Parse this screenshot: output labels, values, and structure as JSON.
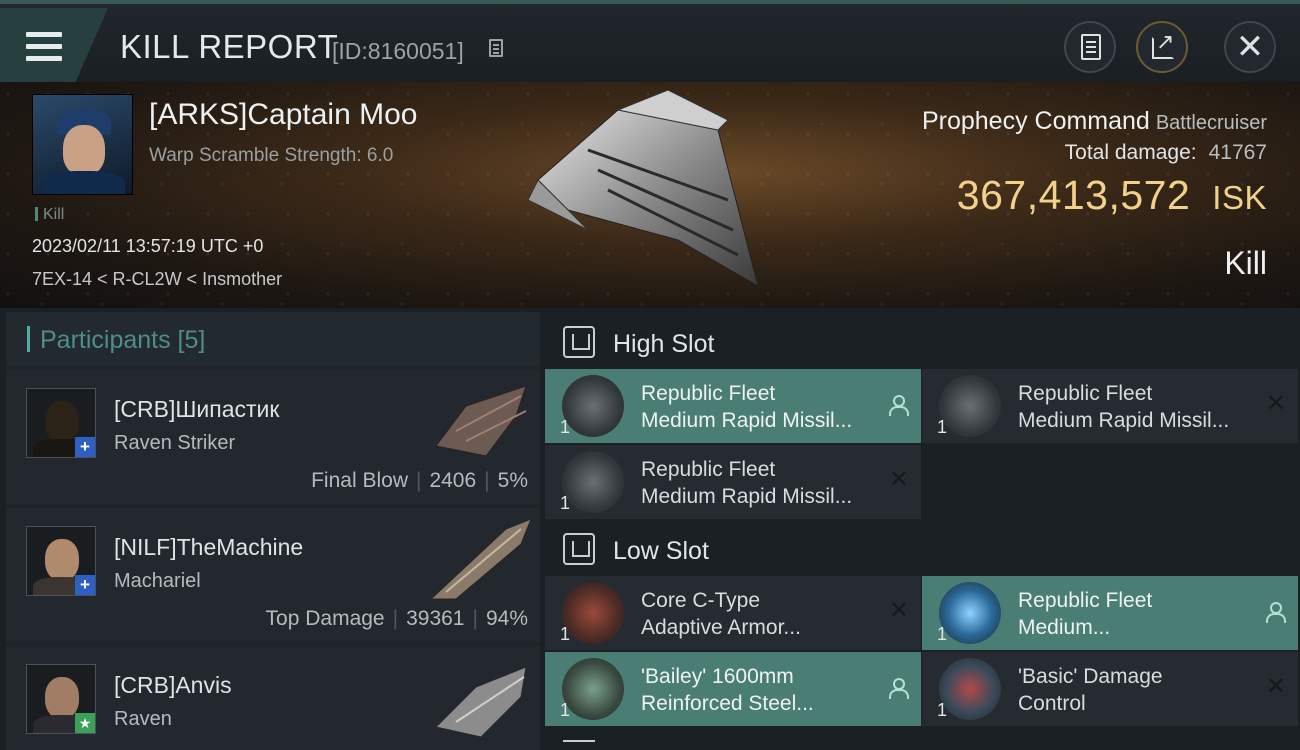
{
  "header": {
    "title": "KILL REPORT",
    "kill_id": "[ID:8160051]"
  },
  "victim": {
    "name": "[ARKS]Captain Moo",
    "warp_scramble": "Warp Scramble Strength: 6.0",
    "tag": "Kill",
    "timestamp": "2023/02/11 13:57:19 UTC +0",
    "location": "7EX-14 < R-CL2W < Insmother"
  },
  "ship": {
    "name": "Prophecy Command",
    "class": "Battlecruiser",
    "total_damage_label": "Total damage:",
    "total_damage": "41767",
    "isk_value": "367,413,572",
    "isk_unit": "ISK",
    "result": "Kill"
  },
  "participants": {
    "title": "Participants [5]",
    "rows": [
      {
        "name": "[CRB]Шипастик",
        "ship": "Raven Striker",
        "label": "Final Blow",
        "damage": "2406",
        "percent": "5%",
        "badge": "+"
      },
      {
        "name": "[NILF]TheMachine",
        "ship": "Machariel",
        "label": "Top Damage",
        "damage": "39361",
        "percent": "94%",
        "badge": "+"
      },
      {
        "name": "[CRB]Anvis",
        "ship": "Raven",
        "badge": "★"
      }
    ]
  },
  "fitting": {
    "high_slot_label": "High Slot",
    "low_slot_label": "Low Slot",
    "high": [
      {
        "line1": "Republic Fleet",
        "line2": "Medium Rapid Missil...",
        "qty": "1",
        "state": "person-icon",
        "highlight": true
      },
      {
        "line1": "Republic Fleet",
        "line2": "Medium Rapid Missil...",
        "qty": "1",
        "state": "close-icon",
        "highlight": false
      },
      {
        "line1": "Republic Fleet",
        "line2": "Medium Rapid Missil...",
        "qty": "1",
        "state": "close-icon",
        "highlight": false
      }
    ],
    "low": [
      {
        "line1": "Core C-Type",
        "line2": "Adaptive Armor...",
        "qty": "1",
        "state": "close-icon",
        "highlight": false
      },
      {
        "line1": "Republic Fleet",
        "line2": "Medium...",
        "qty": "1",
        "state": "person-icon",
        "highlight": true
      },
      {
        "line1": "'Bailey' 1600mm",
        "line2": "Reinforced Steel...",
        "qty": "1",
        "state": "person-icon",
        "highlight": true
      },
      {
        "line1": "'Basic' Damage",
        "line2": "Control",
        "qty": "1",
        "state": "close-icon",
        "highlight": false
      }
    ]
  },
  "colors": {
    "accent_teal": "#4a7e74",
    "isk_gold": "#f2d28b",
    "badge_blue": "#2d5fc4",
    "badge_green": "#3ba05a"
  }
}
